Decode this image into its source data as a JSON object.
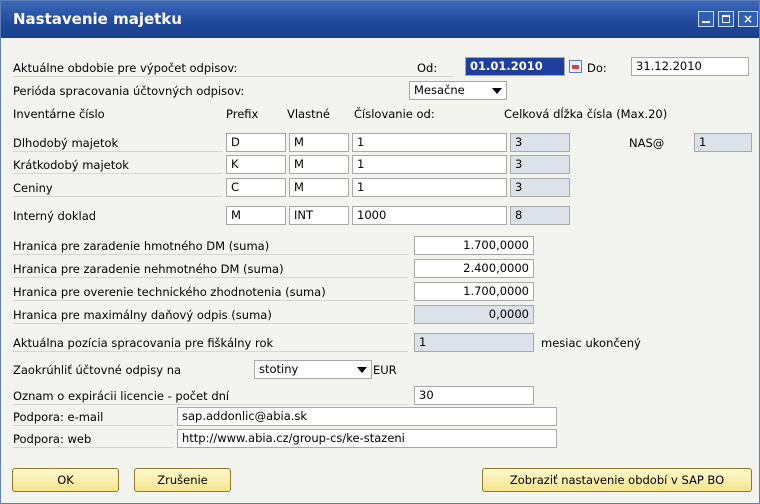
{
  "window": {
    "title": "Nastavenie majetku"
  },
  "period": {
    "label": "Aktuálne obdobie pre výpočet odpisov:",
    "from_label": "Od:",
    "from_value": "01.01.2010",
    "to_label": "Do:",
    "to_value": "31.12.2010"
  },
  "processing_period": {
    "label": "Perióda spracovania účtovných odpisov:",
    "value": "Mesačne"
  },
  "inventory": {
    "header": {
      "col1": "Inventárne číslo",
      "prefix": "Prefix",
      "own": "Vlastné",
      "numbering": "Číslovanie od:",
      "total": "Celková dĺžka čísla (Max.20)"
    },
    "rows": [
      {
        "label": "Dlhodobý majetok",
        "prefix": "D",
        "own": "M",
        "from": "1",
        "len": "3"
      },
      {
        "label": "Krátkodobý majetok",
        "prefix": "K",
        "own": "M",
        "from": "1",
        "len": "3"
      },
      {
        "label": "Ceniny",
        "prefix": "C",
        "own": "M",
        "from": "1",
        "len": "3"
      },
      {
        "label": "Interný doklad",
        "prefix": "M",
        "own": "INT",
        "from": "1000",
        "len": "8"
      }
    ],
    "nas_label": "NAS@",
    "nas_value": "1"
  },
  "limits": [
    {
      "label": "Hranica pre zaradenie hmotného DM (suma)",
      "value": "1.700,0000"
    },
    {
      "label": "Hranica pre zaradenie nehmotného DM (suma)",
      "value": "2.400,0000"
    },
    {
      "label": "Hranica pre overenie technického zhodnotenia (suma)",
      "value": "1.700,0000"
    },
    {
      "label": "Hranica pre maximálny daňový odpis (suma)",
      "value": "0,0000"
    }
  ],
  "fiscal": {
    "label": "Aktuálna pozícia spracovania pre fiškálny rok",
    "value": "1",
    "suffix": "mesiac ukončený"
  },
  "rounding": {
    "label": "Zaokrúhliť účtovné odpisy na",
    "value": "stotiny",
    "currency": "EUR"
  },
  "license": {
    "label": "Oznam o expirácii licencie - počet dní",
    "value": "30"
  },
  "support": {
    "email_label": "Podpora: e-mail",
    "email": "sap.addonlic@abia.sk",
    "web_label": "Podpora: web",
    "web": "http://www.abia.cz/group-cs/ke-stazeni"
  },
  "buttons": {
    "ok": "OK",
    "cancel": "Zrušenie",
    "show_periods": "Zobraziť nastavenie období v SAP BO"
  }
}
